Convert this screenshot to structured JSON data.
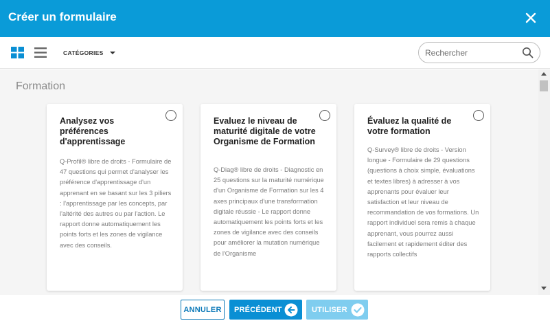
{
  "header": {
    "title": "Créer un formulaire"
  },
  "toolbar": {
    "categories_label": "CATÉGORIES",
    "search_placeholder": "Rechercher"
  },
  "section": {
    "title": "Formation"
  },
  "cards": [
    {
      "title": "Analysez vos préférences d'apprentissage",
      "description": "Q-Profil® libre de droits - Formulaire de 47 questions qui permet d'analyser les préférence d'apprentissage d'un apprenant en se basant sur les 3 piliers : l'apprentissage par les concepts, par l'altérité des autres ou par l'action. Le rapport donne automatiquement les points forts et les zones de vigilance avec des conseils."
    },
    {
      "title": "Evaluez le niveau de maturité digitale de votre Organisme de Formation",
      "description": "Q-Diag® libre de droits - Diagnostic en 25 questions sur la maturité numérique d'un Organisme de Formation sur les 4 axes principaux d'une transformation digitale réussie - Le rapport donne automatiquement les points forts et les zones de vigilance avec des conseils pour améliorer la mutation numérique de l'Organisme"
    },
    {
      "title": "Évaluez la qualité de votre formation",
      "description": "Q-Survey® libre de droits - Version longue - Formulaire de 29 questions (questions à choix simple, évaluations et textes libres) à adresser à vos apprenants pour évaluer leur satisfaction et leur niveau de recommandation de vos formations. Un rapport individuel sera remis à chaque apprenant, vous pourrez aussi facilement et rapidement éditer des rapports collectifs"
    }
  ],
  "footer": {
    "cancel_label": "ANNULER",
    "previous_label": "PRÉCÉDENT",
    "use_label": "UTILISER"
  },
  "colors": {
    "header_bg": "#0a9bd8",
    "primary_button": "#0a8fd4",
    "disabled_button": "#7fcdef",
    "view_icon_active": "#0a8fd4"
  },
  "icons": {
    "close": "close-icon",
    "grid_view": "grid-view-icon",
    "list_view": "list-view-icon",
    "search": "search-icon",
    "arrow_left": "arrow-left-icon",
    "check": "check-icon"
  }
}
